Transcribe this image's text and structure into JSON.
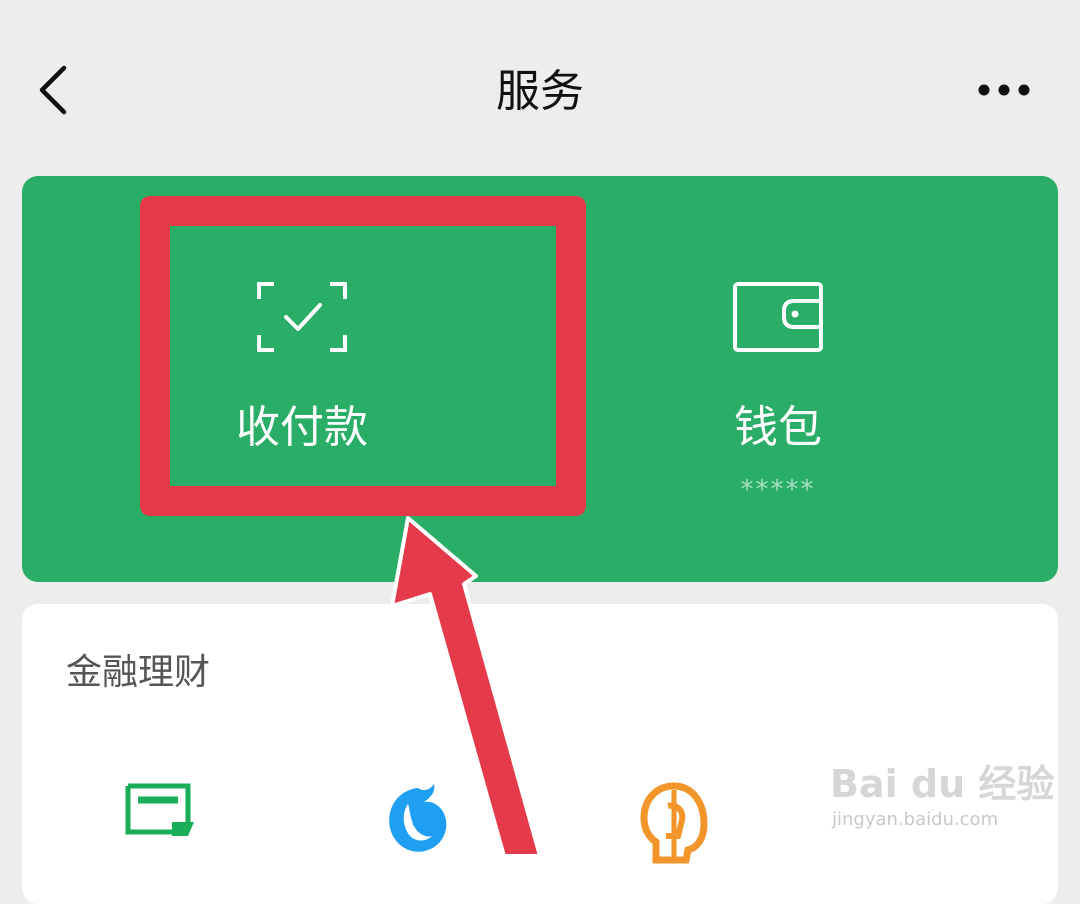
{
  "header": {
    "title": "服务",
    "back_icon": "back-chevron-icon",
    "more_icon": "more-dots-icon"
  },
  "top_card": {
    "background_color": "#2aae67",
    "pay": {
      "label": "收付款",
      "icon": "scan-check-icon"
    },
    "wallet": {
      "label": "钱包",
      "balance": "*****",
      "icon": "wallet-icon"
    }
  },
  "finance": {
    "title": "金融理财",
    "items": [
      {
        "icon": "card-icon",
        "color": "#1aad58"
      },
      {
        "icon": "fund-icon",
        "color": "#1e9ff2"
      },
      {
        "icon": "insurance-icon",
        "color": "#f2952b"
      }
    ]
  },
  "annotation": {
    "highlight_color": "#e53a4a"
  },
  "watermark": {
    "logo_text": "Bai du 经验",
    "url": "jingyan.baidu.com"
  }
}
